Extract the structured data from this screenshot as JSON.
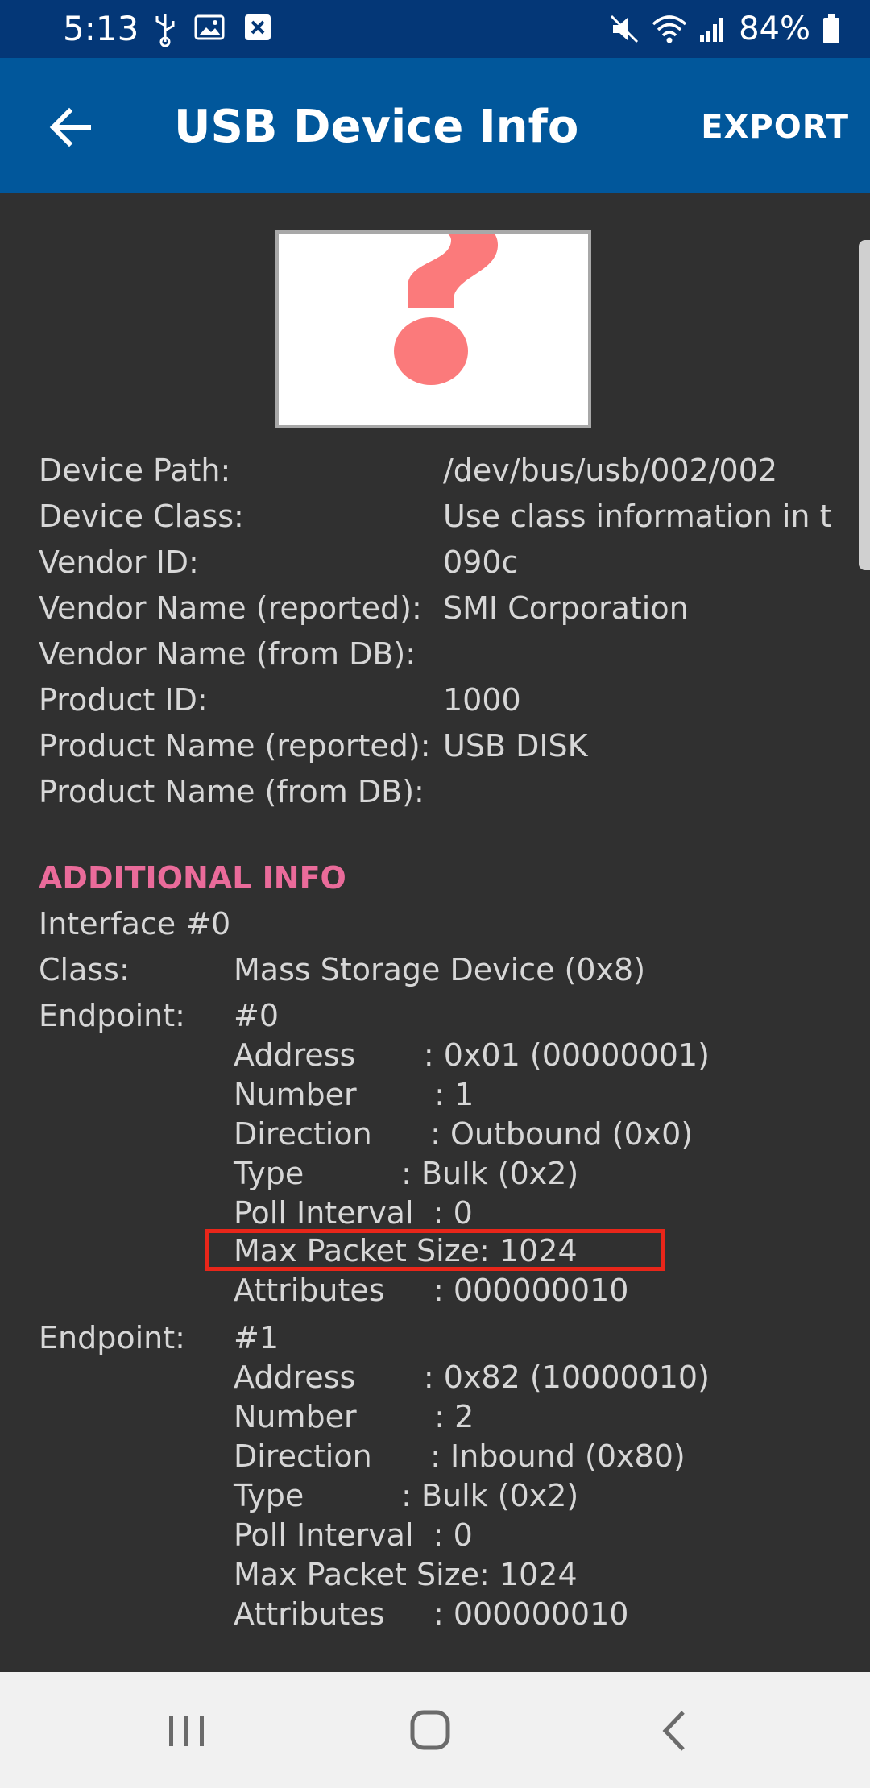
{
  "status_bar": {
    "time": "5:13",
    "battery_percent": "84%",
    "icons_left": [
      "usb-icon",
      "image-icon",
      "close-box-icon"
    ],
    "icons_right": [
      "mute-icon",
      "wifi-icon",
      "signal-icon",
      "battery-icon"
    ]
  },
  "app_bar": {
    "title": "USB Device Info",
    "back_icon": "arrow-back-icon",
    "export_label": "EXPORT",
    "color": "#01579b"
  },
  "device": {
    "image_icon": "question-mark-icon",
    "fields": [
      {
        "label": "Device Path:",
        "value": "/dev/bus/usb/002/002"
      },
      {
        "label": "Device Class:",
        "value": "Use class information in th"
      },
      {
        "label": "Vendor ID:",
        "value": "090c"
      },
      {
        "label": "Vendor Name (reported):",
        "value": "SMI Corporation"
      },
      {
        "label": "Vendor Name (from DB):",
        "value": ""
      },
      {
        "label": "Product ID:",
        "value": "1000"
      },
      {
        "label": "Product Name (reported):",
        "value": "USB DISK"
      },
      {
        "label": "Product Name (from DB):",
        "value": ""
      }
    ]
  },
  "additional_info": {
    "header": "ADDITIONAL INFO",
    "header_color": "#ea6b9a",
    "interface_title": "Interface #0",
    "class_label": "Class:",
    "class_value": "Mass Storage Device (0x8)",
    "endpoint_label": "Endpoint:",
    "endpoints": [
      {
        "id": "#0",
        "address": "Address       : 0x01 (00000001)",
        "number": "Number        : 1",
        "direction": "Direction      : Outbound (0x0)",
        "type": "Type          : Bulk (0x2)",
        "poll": "Poll Interval  : 0",
        "max_packet": "Max Packet Size: 1024",
        "attributes": "Attributes     : 000000010"
      },
      {
        "id": "#1",
        "address": "Address       : 0x82 (10000010)",
        "number": "Number        : 2",
        "direction": "Direction      : Inbound (0x80)",
        "type": "Type          : Bulk (0x2)",
        "poll": "Poll Interval  : 0",
        "max_packet": "Max Packet Size: 1024",
        "attributes": "Attributes     : 000000010"
      }
    ],
    "highlight_color": "#e8261a"
  },
  "nav_bar": {
    "recents_icon": "recents-icon",
    "home_icon": "home-icon",
    "back_icon": "nav-back-icon"
  }
}
